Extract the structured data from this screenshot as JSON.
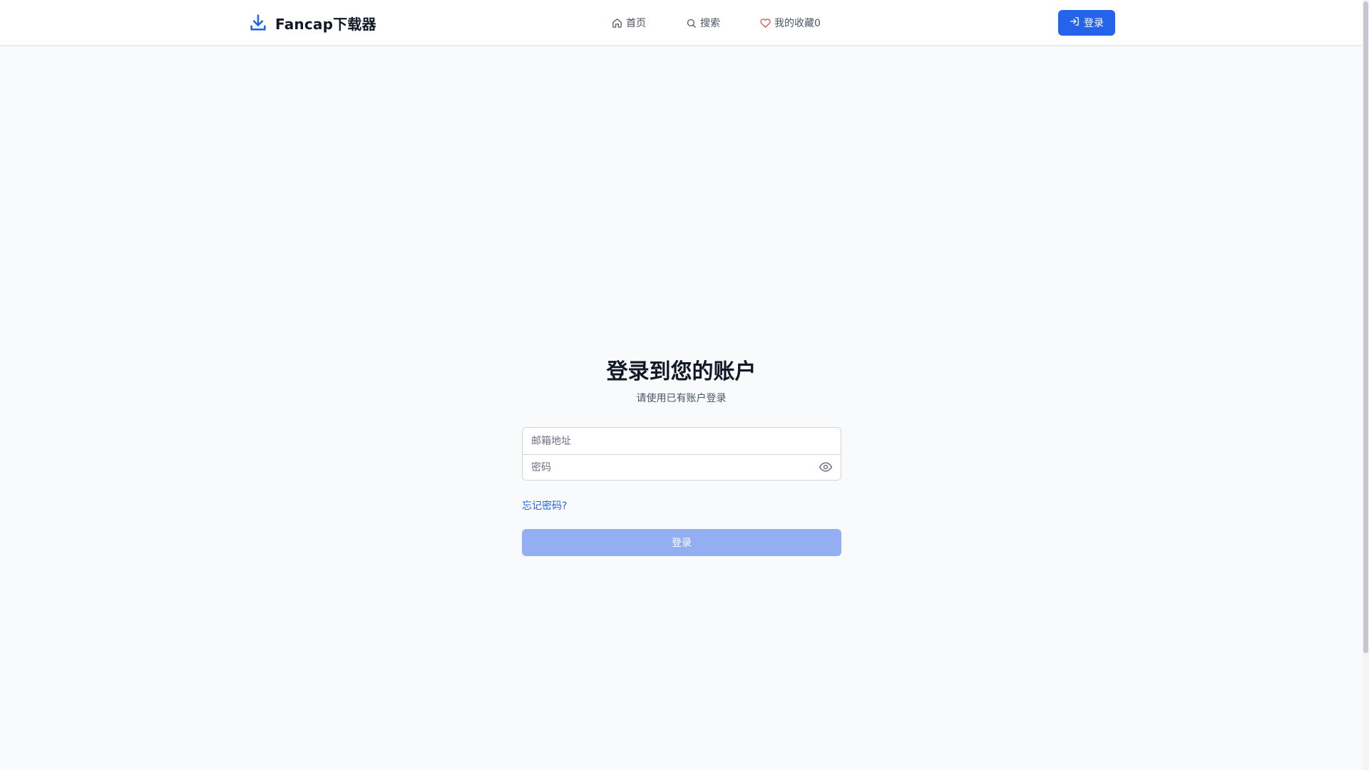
{
  "header": {
    "brand": {
      "name": "Fancap下载器",
      "icon": "download-icon"
    },
    "nav": [
      {
        "label": "首页",
        "icon": "home-icon"
      },
      {
        "label": "搜索",
        "icon": "search-icon"
      },
      {
        "label": "我的收藏0",
        "icon": "heart-icon"
      }
    ],
    "login_button": {
      "label": "登录",
      "icon": "login-icon"
    }
  },
  "login_form": {
    "title": "登录到您的账户",
    "subtitle": "请使用已有账户登录",
    "email": {
      "placeholder": "邮箱地址",
      "value": ""
    },
    "password": {
      "placeholder": "密码",
      "value": "",
      "toggle_icon": "eye-icon"
    },
    "forgot_link": "忘记密码?",
    "submit_label": "登录"
  },
  "colors": {
    "primary": "#2563eb",
    "primary_disabled": "#93aff2",
    "heart": "#ef4444",
    "background": "#f8fafc"
  }
}
